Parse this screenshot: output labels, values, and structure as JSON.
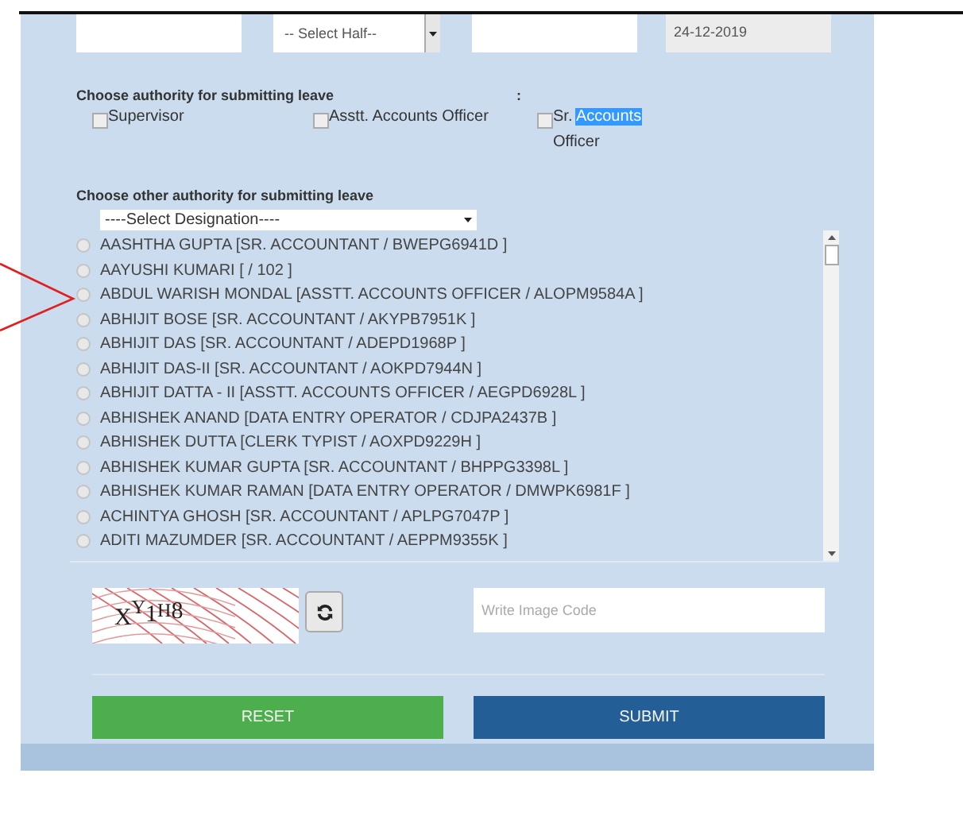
{
  "top_fields": {
    "half_select": {
      "value": "-- Select Half--"
    },
    "date": {
      "value": "24-12-2019"
    }
  },
  "authority": {
    "heading": "Choose authority for submitting leave",
    "colon": ":",
    "options": [
      {
        "label_parts": [
          {
            "text": "Supervisor",
            "highlighted": false
          }
        ],
        "checked": false
      },
      {
        "label_parts": [
          {
            "text": "Asstt. Accounts Officer",
            "highlighted": false
          }
        ],
        "checked": false
      },
      {
        "label_parts": [
          {
            "text": "Sr. ",
            "highlighted": false
          },
          {
            "text": "Accounts",
            "highlighted": true
          },
          {
            "text": " Officer",
            "highlighted": false
          }
        ],
        "checked": false
      }
    ]
  },
  "other_authority": {
    "heading": "Choose other authority for submitting leave",
    "designation_select": {
      "value": "----Select Designation----"
    },
    "people": [
      {
        "label": "AASHTHA GUPTA [SR. ACCOUNTANT / BWEPG6941D ]",
        "selected": false
      },
      {
        "label": "AAYUSHI KUMARI [ / 102 ]",
        "selected": false
      },
      {
        "label": "ABDUL WARISH MONDAL [ASSTT. ACCOUNTS OFFICER / ALOPM9584A ]",
        "selected": false
      },
      {
        "label": "ABHIJIT BOSE [SR. ACCOUNTANT / AKYPB7951K ]",
        "selected": false
      },
      {
        "label": "ABHIJIT DAS [SR. ACCOUNTANT / ADEPD1968P ]",
        "selected": false
      },
      {
        "label": "ABHIJIT DAS-II [SR. ACCOUNTANT / AOKPD7944N ]",
        "selected": false
      },
      {
        "label": "ABHIJIT DATTA - II [ASSTT. ACCOUNTS OFFICER / AEGPD6928L ]",
        "selected": false
      },
      {
        "label": "ABHISHEK ANAND [DATA ENTRY OPERATOR / CDJPA2437B ]",
        "selected": false
      },
      {
        "label": "ABHISHEK DUTTA [CLERK TYPIST / AOXPD9229H ]",
        "selected": false
      },
      {
        "label": "ABHISHEK KUMAR GUPTA [SR. ACCOUNTANT / BHPPG3398L ]",
        "selected": false
      },
      {
        "label": "ABHISHEK KUMAR RAMAN [DATA ENTRY OPERATOR / DMWPK6981F ]",
        "selected": false
      },
      {
        "label": "ACHINTYA GHOSH [SR. ACCOUNTANT / APLPG7047P ]",
        "selected": false
      },
      {
        "label": "ADITI MAZUMDER [SR. ACCOUNTANT / AEPPM9355K ]",
        "selected": false
      }
    ]
  },
  "captcha": {
    "chars": [
      "X",
      "Y",
      "1",
      "H",
      "8"
    ],
    "input": {
      "placeholder": "Write Image Code"
    }
  },
  "buttons": [
    {
      "label": "RESET",
      "kind": "reset"
    },
    {
      "label": "SUBMIT",
      "kind": "submit"
    }
  ]
}
